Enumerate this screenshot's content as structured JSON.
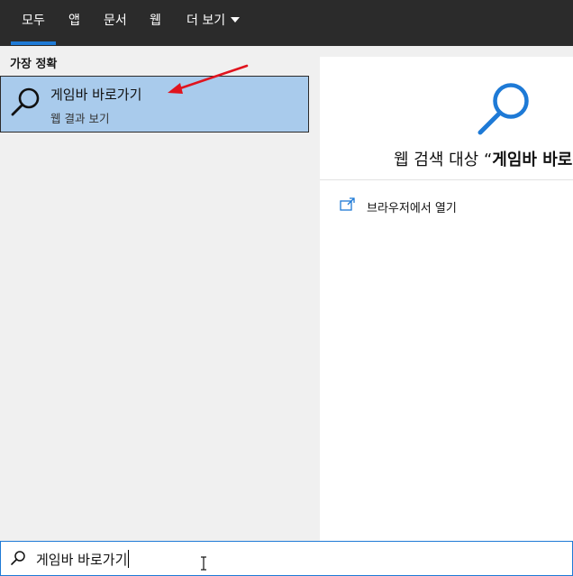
{
  "tabs": [
    {
      "label": "모두",
      "active": true
    },
    {
      "label": "앱",
      "active": false
    },
    {
      "label": "문서",
      "active": false
    },
    {
      "label": "웹",
      "active": false
    },
    {
      "label": "더 보기",
      "active": false
    }
  ],
  "left_panel": {
    "section_label": "가장 정확",
    "best_match": {
      "title": "게임바 바로가기",
      "subtitle": "웹 결과 보기",
      "icon": "search-icon"
    }
  },
  "right_panel": {
    "heading_prefix": "웹 검색 대상 “",
    "heading_query": "게임바 바로",
    "open_browser_label": "브라우저에서 열기",
    "icons": [
      "search-icon",
      "open-external-icon"
    ]
  },
  "search_bar": {
    "value": "게임바 바로가기",
    "icon": "search-icon"
  },
  "colors": {
    "topbar_bg": "#2b2b2b",
    "accent": "#1e7ad6",
    "selected_bg": "#a9cbec",
    "annotation_arrow": "#e0141e"
  }
}
